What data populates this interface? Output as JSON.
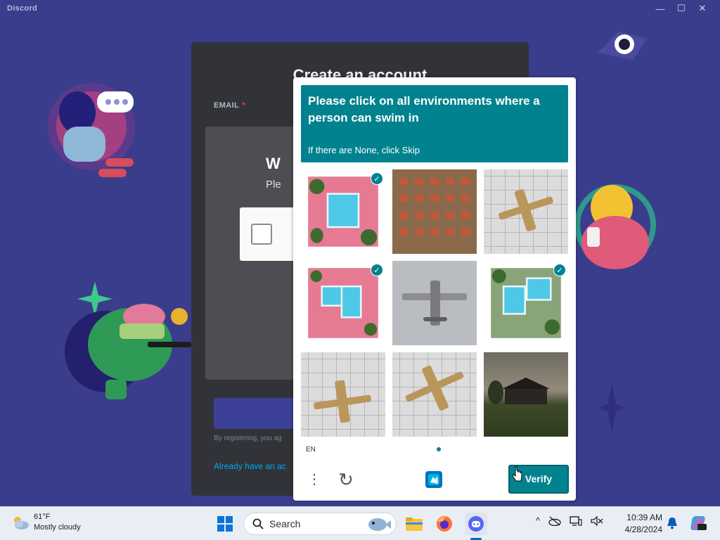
{
  "window": {
    "title": "Discord",
    "controls": {
      "minimize": "—",
      "maximize": "☐",
      "close": "✕"
    }
  },
  "register": {
    "title": "Create an account",
    "email_label": "EMAIL",
    "email_required": "*",
    "welcome_fragment": "W",
    "please_fragment": "Ple",
    "terms_fragment": "By registering, you ag",
    "login_fragment": "Already have an ac"
  },
  "captcha": {
    "prompt": "Please click on all environments where a person can swim in",
    "sub": "If there are None, click Skip",
    "language": "EN",
    "verify_label": "Verify",
    "menu_icon": "⋮",
    "refresh_icon": "↻",
    "accent_color": "#00838f",
    "tiles": [
      {
        "name": "pool-aerial-1",
        "selected": true
      },
      {
        "name": "tables-aerial",
        "selected": false
      },
      {
        "name": "plane-on-tiles-1",
        "selected": false
      },
      {
        "name": "pool-aerial-2",
        "selected": true
      },
      {
        "name": "plane-snow",
        "selected": false
      },
      {
        "name": "pool-aerial-3",
        "selected": true
      },
      {
        "name": "plane-on-tiles-2",
        "selected": false
      },
      {
        "name": "plane-on-tiles-3",
        "selected": false
      },
      {
        "name": "house-dusk",
        "selected": false
      }
    ],
    "check_mark": "✓"
  },
  "taskbar": {
    "weather_temp": "61°F",
    "weather_desc": "Mostly cloudy",
    "search_label": "Search",
    "time": "10:39 AM",
    "date": "4/28/2024",
    "tray_chevron": "^"
  }
}
